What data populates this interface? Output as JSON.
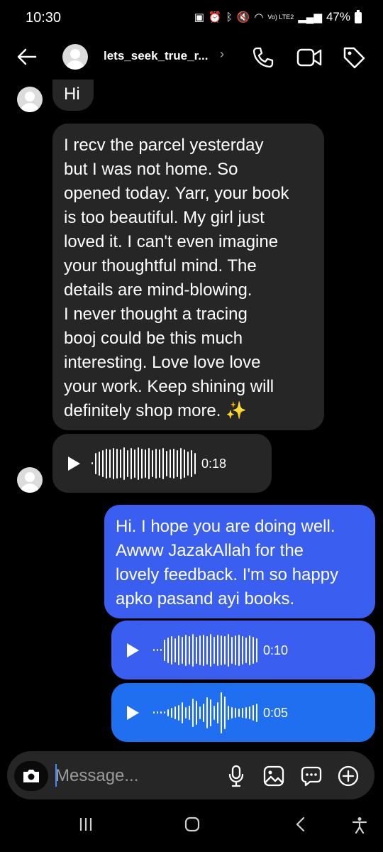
{
  "status_bar": {
    "time": "10:30",
    "battery": "47%",
    "network_label": "Vo) LTE2"
  },
  "header": {
    "contact_name": "lets_seek_true_r...",
    "icons": [
      "back-arrow-icon",
      "chevron-right-icon",
      "phone-icon",
      "video-icon",
      "tag-icon"
    ]
  },
  "messages": [
    {
      "sender": "contact",
      "type": "text",
      "text": "Hi"
    },
    {
      "sender": "contact",
      "type": "text",
      "text": "I recv the parcel yesterday\nbut I was not home. So\nopened today. Yarr, your book\nis too beautiful. My girl just\nloved it. I can't even imagine\nyour thoughtful mind. The\ndetails are mind-blowing.\nI never thought a tracing\nbooj could be this much\ninteresting. Love love love\nyour work. Keep shining will\ndefinitely shop more. ✨"
    },
    {
      "sender": "contact",
      "type": "voice",
      "duration": "0:18"
    },
    {
      "sender": "me",
      "type": "text",
      "text": "Hi. I hope you are doing well.\nAwww JazakAllah for the\nlovely feedback. I'm so happy\napko pasand ayi books."
    },
    {
      "sender": "me",
      "type": "voice",
      "duration": "0:10"
    },
    {
      "sender": "me",
      "type": "voice",
      "duration": "0:05"
    }
  ],
  "composer": {
    "placeholder": "Message...",
    "icons": [
      "camera-icon",
      "mic-icon",
      "gallery-icon",
      "sticker-icon",
      "add-icon"
    ]
  },
  "colors": {
    "incoming_bubble": "#262626",
    "outgoing_bubble_top": "#3a5ff0",
    "outgoing_bubble_bottom": "#1f6ff0",
    "background": "#000000"
  }
}
